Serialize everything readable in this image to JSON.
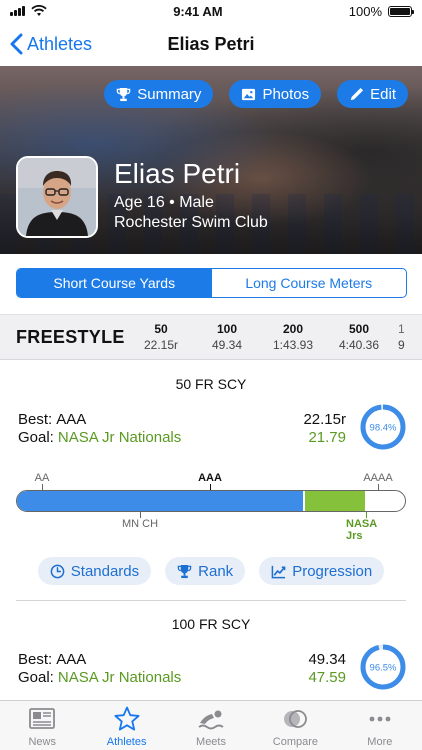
{
  "status": {
    "time": "9:41 AM",
    "battery": "100%"
  },
  "nav": {
    "back_label": "Athletes",
    "title": "Elias Petri"
  },
  "hero": {
    "buttons": {
      "summary": "Summary",
      "photos": "Photos",
      "edit": "Edit"
    },
    "name": "Elias Petri",
    "age_line": "Age 16 • Male",
    "club": "Rochester Swim Club"
  },
  "course_toggle": {
    "short": "Short Course Yards",
    "long": "Long Course Meters",
    "selected": "short"
  },
  "stroke": {
    "name": "FREESTYLE",
    "events": [
      {
        "distance": "50",
        "time": "22.15r"
      },
      {
        "distance": "100",
        "time": "49.34"
      },
      {
        "distance": "200",
        "time": "1:43.93"
      },
      {
        "distance": "500",
        "time": "4:40.36"
      },
      {
        "distance": "1",
        "time": "9"
      }
    ]
  },
  "event1": {
    "title": "50 FR SCY",
    "best_label": "Best:",
    "best_standard": "AAA",
    "best_time": "22.15r",
    "goal_label": "Goal:",
    "goal_standard": "NASA Jr Nationals",
    "goal_time": "21.79",
    "percent": "98.4%",
    "progress_fraction": 0.984,
    "bar": {
      "top_labels": {
        "aa": "AA",
        "aaa": "AAA",
        "aaaa": "AAAA"
      },
      "bottom_labels": {
        "mnch": "MN CH",
        "nasa": "NASA Jrs"
      }
    },
    "actions": {
      "standards": "Standards",
      "rank": "Rank",
      "progression": "Progression"
    }
  },
  "event2": {
    "title": "100 FR SCY",
    "best_label": "Best:",
    "best_standard": "AAA",
    "best_time": "49.34",
    "goal_label": "Goal:",
    "goal_standard": "NASA Jr Nationals",
    "goal_time": "47.59",
    "percent": "96.5%",
    "progress_fraction": 0.965
  },
  "tabs": [
    {
      "label": "News",
      "icon": "news-icon"
    },
    {
      "label": "Athletes",
      "icon": "star-icon",
      "active": true
    },
    {
      "label": "Meets",
      "icon": "swimmer-icon"
    },
    {
      "label": "Compare",
      "icon": "compare-icon"
    },
    {
      "label": "More",
      "icon": "more-icon"
    }
  ],
  "colors": {
    "accent": "#1d7be8",
    "goal_green": "#5a9a22",
    "bar_blue": "#3d8ce7",
    "bar_green": "#86c13b"
  }
}
